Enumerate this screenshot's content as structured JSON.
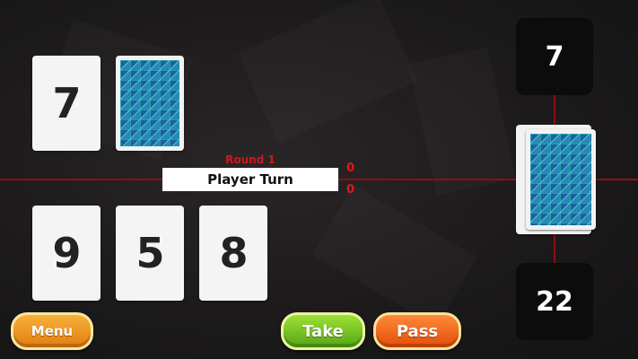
{
  "top_hand": [
    "7"
  ],
  "bottom_hand": [
    "9",
    "5",
    "8"
  ],
  "round_label": "Round 1",
  "turn_status": "Player Turn",
  "scores": {
    "top": "0",
    "bottom": "0"
  },
  "counters": {
    "top": "7",
    "bottom": "22"
  },
  "buttons": {
    "menu": "Menu",
    "take": "Take",
    "pass": "Pass"
  },
  "colors": {
    "card_back_blue": "#1f5f9e",
    "card_back_teal": "#2ec4c0",
    "table_line": "#8c0f14",
    "round_red": "#d01818",
    "take_green": "#7cc623",
    "pass_orange": "#f26a1b",
    "menu_orange": "#f0a02a"
  },
  "icons": {
    "card_back": "triangle-pattern-card-back"
  }
}
